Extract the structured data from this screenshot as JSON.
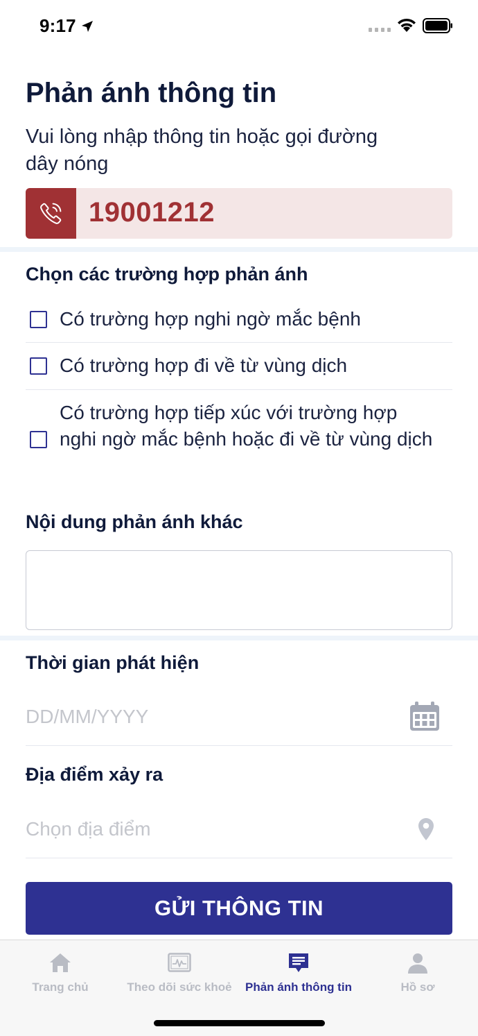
{
  "status_bar": {
    "time": "9:17"
  },
  "header": {
    "title": "Phản ánh thông tin",
    "subtitle": "Vui lòng nhập thông tin hoặc gọi đường dây nóng"
  },
  "hotline": {
    "number": "19001212",
    "icon": "phone-icon"
  },
  "cases": {
    "label": "Chọn các trường hợp phản ánh",
    "options": [
      {
        "label": "Có trường hợp nghi ngờ mắc bệnh",
        "checked": false
      },
      {
        "label": "Có trường hợp đi về từ vùng dịch",
        "checked": false
      },
      {
        "label": "Có trường hợp tiếp xúc với trường hợp nghi ngờ mắc bệnh hoặc đi về từ vùng dịch",
        "checked": false
      }
    ]
  },
  "other_content": {
    "label": "Nội dung phản ánh khác",
    "value": ""
  },
  "detection_time": {
    "label": "Thời gian phát hiện",
    "placeholder": "DD/MM/YYYY",
    "icon": "calendar-icon"
  },
  "location": {
    "label": "Địa điểm xảy ra",
    "placeholder": "Chọn địa điểm",
    "icon": "location-pin-icon"
  },
  "submit": {
    "label": "GỬI THÔNG TIN"
  },
  "tab_bar": {
    "tabs": [
      {
        "label": "Trang chủ",
        "icon": "home-icon",
        "active": false
      },
      {
        "label": "Theo dõi sức khoẻ",
        "icon": "health-monitor-icon",
        "active": false
      },
      {
        "label": "Phản ánh thông tin",
        "icon": "message-icon",
        "active": true
      },
      {
        "label": "Hồ sơ",
        "icon": "profile-icon",
        "active": false
      }
    ]
  },
  "colors": {
    "primary": "#2e3192",
    "hotline_accent": "#a03134",
    "hotline_bg": "#f4e6e6",
    "placeholder": "#c4c6cc",
    "inactive_tab": "#b9bcc4"
  }
}
